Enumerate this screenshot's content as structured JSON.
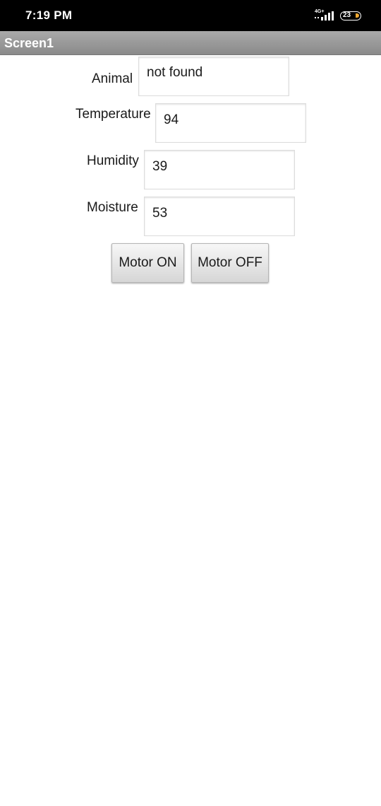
{
  "status_bar": {
    "time": "7:19 PM",
    "network": "4G+",
    "battery_level": "23",
    "icons": [
      "signal-icon",
      "battery-icon"
    ]
  },
  "app": {
    "title": "Screen1"
  },
  "fields": [
    {
      "label": "Animal",
      "value": "not found"
    },
    {
      "label": "Temperature",
      "value": "94"
    },
    {
      "label": "Humidity",
      "value": "39"
    },
    {
      "label": "Moisture",
      "value": "53"
    }
  ],
  "buttons": {
    "motor_on": "Motor ON",
    "motor_off": "Motor OFF"
  },
  "colors": {
    "status_bar_bg": "#000000",
    "title_bar_bg": "#999999",
    "battery_accent": "#f0a830"
  }
}
